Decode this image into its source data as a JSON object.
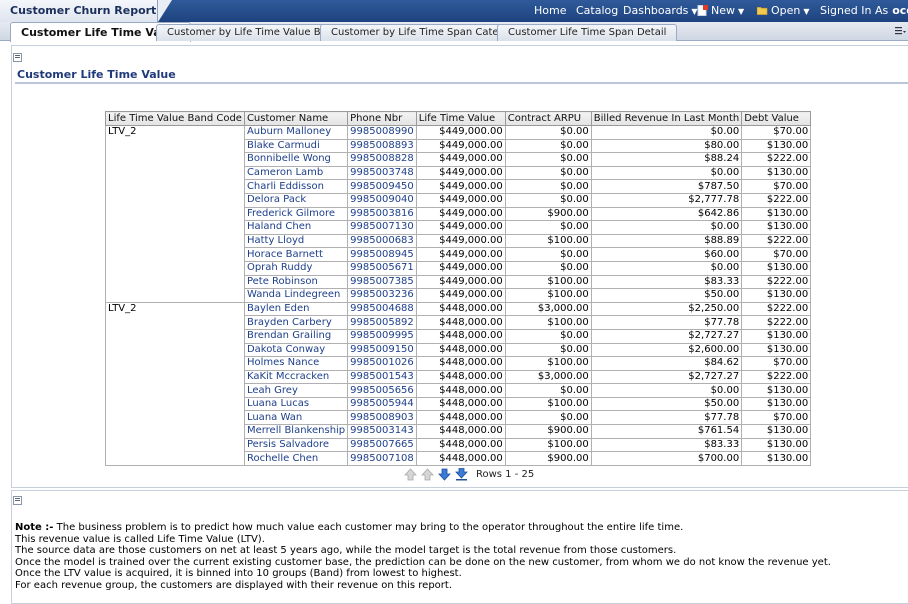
{
  "app": {
    "title": "Customer Churn Report"
  },
  "nav": {
    "home": "Home",
    "catalog": "Catalog",
    "dashboards": "Dashboards",
    "new": "New",
    "open": "Open",
    "signed_in_label": "Signed In As",
    "user": "ocdm"
  },
  "tabs": [
    {
      "label": "Customer Life Time Value"
    },
    {
      "label": "Customer by Life Time Value Band"
    },
    {
      "label": "Customer by Life Time Span Category"
    },
    {
      "label": "Customer Life Time Span Detail"
    }
  ],
  "section": {
    "title": "Customer Life Time Value"
  },
  "table": {
    "columns": [
      "Life Time Value Band Code",
      "Customer Name",
      "Phone Nbr",
      "Life Time Value",
      "Contract ARPU",
      "Billed Revenue In Last Month",
      "Debt Value"
    ],
    "groups": [
      {
        "band": "LTV_2",
        "rows": [
          [
            "Auburn Malloney",
            "9985008990",
            "$449,000.00",
            "$0.00",
            "$0.00",
            "$70.00"
          ],
          [
            "Blake Carmudi",
            "9985008893",
            "$449,000.00",
            "$0.00",
            "$80.00",
            "$130.00"
          ],
          [
            "Bonnibelle Wong",
            "9985008828",
            "$449,000.00",
            "$0.00",
            "$88.24",
            "$222.00"
          ],
          [
            "Cameron Lamb",
            "9985003748",
            "$449,000.00",
            "$0.00",
            "$0.00",
            "$130.00"
          ],
          [
            "Charli Eddisson",
            "9985009450",
            "$449,000.00",
            "$0.00",
            "$787.50",
            "$70.00"
          ],
          [
            "Delora Pack",
            "9985009040",
            "$449,000.00",
            "$0.00",
            "$2,777.78",
            "$222.00"
          ],
          [
            "Frederick Gilmore",
            "9985003816",
            "$449,000.00",
            "$900.00",
            "$642.86",
            "$130.00"
          ],
          [
            "Haland Chen",
            "9985007130",
            "$449,000.00",
            "$0.00",
            "$0.00",
            "$130.00"
          ],
          [
            "Hatty Lloyd",
            "9985000683",
            "$449,000.00",
            "$100.00",
            "$88.89",
            "$222.00"
          ],
          [
            "Horace Barnett",
            "9985008945",
            "$449,000.00",
            "$0.00",
            "$60.00",
            "$70.00"
          ],
          [
            "Oprah Ruddy",
            "9985005671",
            "$449,000.00",
            "$0.00",
            "$0.00",
            "$130.00"
          ],
          [
            "Pete Robinson",
            "9985007385",
            "$449,000.00",
            "$100.00",
            "$83.33",
            "$222.00"
          ],
          [
            "Wanda Lindegreen",
            "9985003236",
            "$449,000.00",
            "$100.00",
            "$50.00",
            "$130.00"
          ]
        ]
      },
      {
        "band": "LTV_2",
        "rows": [
          [
            "Baylen Eden",
            "9985004688",
            "$448,000.00",
            "$3,000.00",
            "$2,250.00",
            "$222.00"
          ],
          [
            "Brayden Carbery",
            "9985005892",
            "$448,000.00",
            "$100.00",
            "$77.78",
            "$222.00"
          ],
          [
            "Brendan Grailing",
            "9985009995",
            "$448,000.00",
            "$0.00",
            "$2,727.27",
            "$130.00"
          ],
          [
            "Dakota Conway",
            "9985009150",
            "$448,000.00",
            "$0.00",
            "$2,600.00",
            "$130.00"
          ],
          [
            "Holmes Nance",
            "9985001026",
            "$448,000.00",
            "$100.00",
            "$84.62",
            "$70.00"
          ],
          [
            "KaKit Mccracken",
            "9985001543",
            "$448,000.00",
            "$3,000.00",
            "$2,727.27",
            "$222.00"
          ],
          [
            "Leah Grey",
            "9985005656",
            "$448,000.00",
            "$0.00",
            "$0.00",
            "$130.00"
          ],
          [
            "Luana Lucas",
            "9985005944",
            "$448,000.00",
            "$100.00",
            "$50.00",
            "$130.00"
          ],
          [
            "Luana Wan",
            "9985008903",
            "$448,000.00",
            "$0.00",
            "$77.78",
            "$70.00"
          ],
          [
            "Merrell Blankenship",
            "9985003143",
            "$448,000.00",
            "$900.00",
            "$761.54",
            "$130.00"
          ],
          [
            "Persis Salvadore",
            "9985007665",
            "$448,000.00",
            "$100.00",
            "$83.33",
            "$130.00"
          ],
          [
            "Rochelle Chen",
            "9985007108",
            "$448,000.00",
            "$900.00",
            "$700.00",
            "$130.00"
          ]
        ]
      }
    ]
  },
  "pager": {
    "rows_text": "Rows 1 - 25"
  },
  "notes": {
    "label": "Note :-",
    "lines": [
      "The business problem is to predict how much value each customer may bring to the operator throughout the entire life time.",
      "This revenue value is called Life Time Value (LTV).",
      "The source data are those customers on net at least 5 years ago, while the model target is the total revenue from those customers.",
      "Once the model is trained over the current existing customer base, the prediction can be done on the new customer, from whom we do not know the revenue yet.",
      "Once the LTV value is acquired, it is binned into 10 groups (Band) from lowest to highest.",
      "For each revenue group, the customers are displayed with their revenue on this report."
    ]
  }
}
